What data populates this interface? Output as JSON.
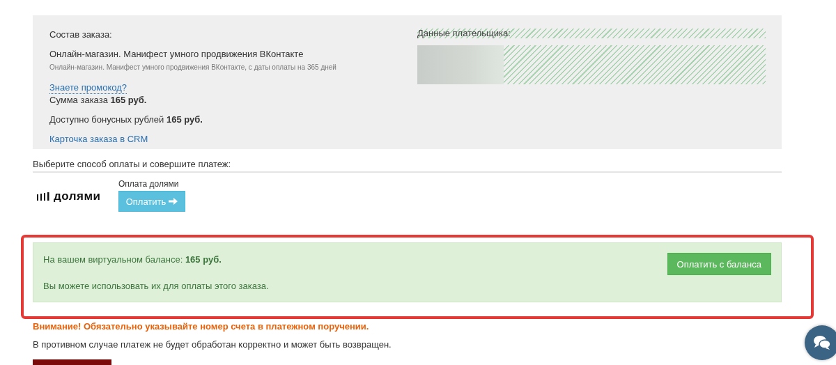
{
  "order": {
    "heading": "Состав заказа:",
    "product_title": "Онлайн-магазин. Манифест умного продвижения ВКонтакте",
    "product_note": "Онлайн-магазин. Манифест умного продвижения ВКонтакте, с даты оплаты на 365 дней",
    "promo_link": "Знаете промокод?",
    "total": "Сумма заказа **165 руб.**",
    "bonus": "Доступно бонусных рублей **165 руб.**",
    "crm_link": "Карточка заказа в CRM"
  },
  "payer": {
    "heading": "Данные плательщика:"
  },
  "payment": {
    "heading": "Выберите способ оплаты и совершите платеж:",
    "logo": "долями",
    "method_label": "Оплата долями",
    "button": "Оплатить"
  },
  "balance": {
    "text": "На вашем виртуальном балансе: **165 руб.**",
    "note": "Вы можете использовать их для оплаты этого заказа.",
    "button": "Оплатить с баланса"
  },
  "warning": "Внимание! Обязательно указывайте номер счета в платежном поручении.",
  "info": "В противном случае платеж не будет обработан корректно и может быть возвращен."
}
